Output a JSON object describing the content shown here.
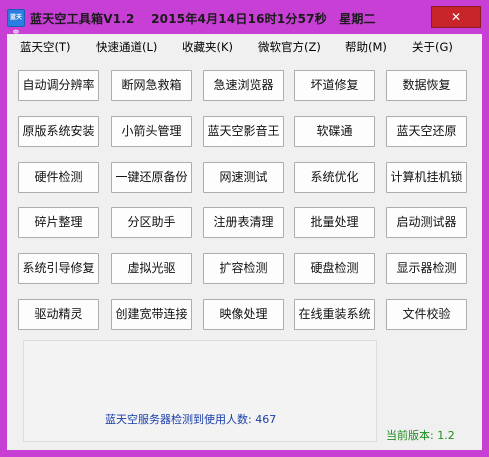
{
  "window": {
    "title": "蓝天空工具箱V1.2　 2015年4月14日16时1分57秒　星期二",
    "app_icon_text": "蓝天空",
    "close_label": "✕"
  },
  "menu": [
    {
      "label": "蓝天空(T)"
    },
    {
      "label": "快速通道(L)"
    },
    {
      "label": "收藏夹(K)"
    },
    {
      "label": "微软官方(Z)"
    },
    {
      "label": "帮助(M)"
    },
    {
      "label": "关于(G)"
    }
  ],
  "buttons": [
    [
      "自动调分辨率",
      "断网急救箱",
      "急速浏览器",
      "坏道修复",
      "数据恢复"
    ],
    [
      "原版系统安装",
      "小箭头管理",
      "蓝天空影音王",
      "软碟通",
      "蓝天空还原"
    ],
    [
      "硬件检测",
      "一键还原备份",
      "网速测试",
      "系统优化",
      "计算机挂机锁"
    ],
    [
      "碎片整理",
      "分区助手",
      "注册表清理",
      "批量处理",
      "启动测试器"
    ],
    [
      "系统引导修复",
      "虚拟光驱",
      "扩容检测",
      "硬盘检测",
      "显示器检测"
    ],
    [
      "驱动精灵",
      "创建宽带连接",
      "映像处理",
      "在线重装系统",
      "文件校验"
    ]
  ],
  "status": {
    "user_count": "蓝天空服务器检测到使用人数: 467",
    "version": "当前版本: 1.2"
  },
  "colors": {
    "frame": "#c83fd6",
    "close": "#c7252a",
    "user_count_text": "#1a3ea8",
    "version_text": "#1f8b1f"
  }
}
